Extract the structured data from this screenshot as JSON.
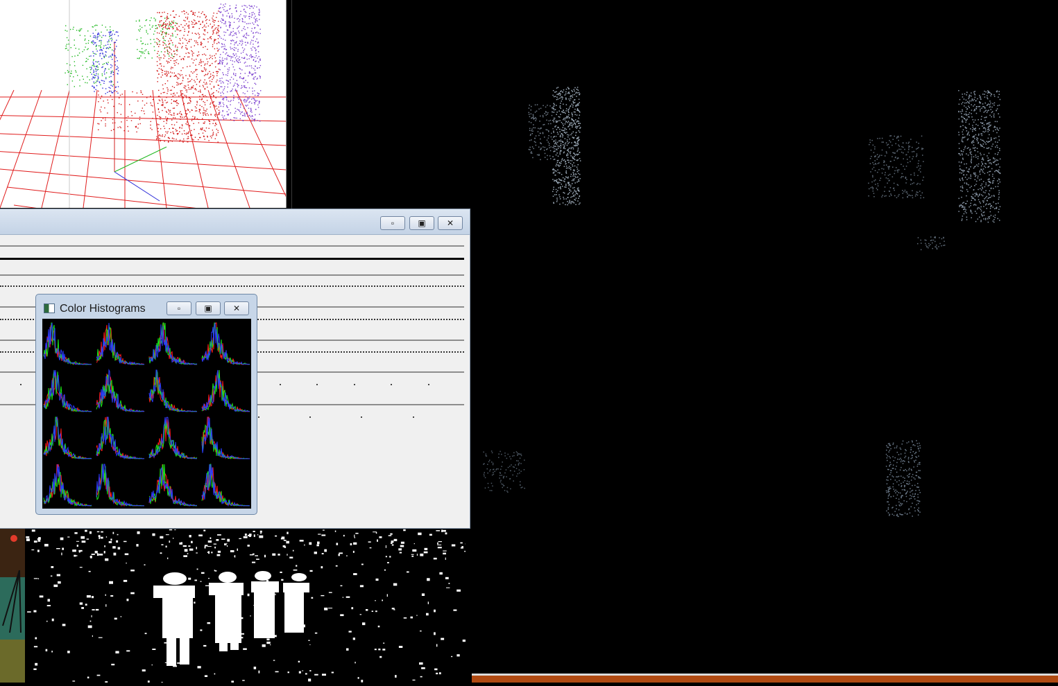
{
  "histogram_window": {
    "title": "Color Histograms",
    "controls": {
      "minimize_icon": "minimize-icon",
      "maximize_icon": "maximize-icon",
      "close_icon": "close-icon"
    }
  },
  "main_window": {
    "controls": {
      "minimize_icon": "minimize-icon",
      "maximize_icon": "maximize-icon",
      "close_icon": "close-icon"
    }
  },
  "colors": {
    "grid": "#e01b1b",
    "cluster_green": "#1fb81f",
    "cluster_blue": "#2a2ad8",
    "cluster_red": "#d11414",
    "cluster_purple": "#7a3fcf",
    "taskbar": "#b04a12"
  }
}
